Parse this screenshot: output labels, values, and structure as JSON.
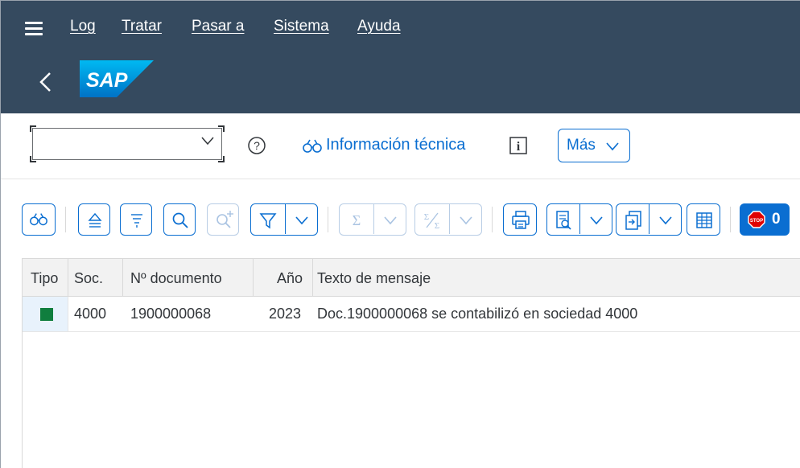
{
  "menu": {
    "items": [
      "Log",
      "Tratar",
      "Pasar a",
      "Sistema",
      "Ayuda"
    ]
  },
  "shell": {
    "logo_text": "SAP"
  },
  "toolbar1": {
    "combo_value": "",
    "info_label": "Información técnica",
    "more_label": "Más"
  },
  "toolbar2": {
    "buttons": [
      "details-icon",
      "sort-ascending-icon",
      "sort-descending-icon",
      "search-icon",
      "search-next-icon",
      "filter-icon",
      "dropdown-icon",
      "sum-icon",
      "dropdown-icon",
      "subtotal-icon",
      "dropdown-icon",
      "print-icon",
      "view-icon",
      "dropdown-icon",
      "export-icon",
      "dropdown-icon",
      "layout-grid-icon"
    ],
    "stop_count": "0"
  },
  "table": {
    "columns": [
      "Tipo",
      "Soc.",
      "Nº documento",
      "Año",
      "Texto de mensaje"
    ],
    "rows": [
      {
        "status": "green",
        "soc": "4000",
        "documento": "1900000068",
        "anio": "2023",
        "texto": "Doc.1900000068 se contabilizó en sociedad 4000"
      }
    ]
  },
  "colors": {
    "shell_bg": "#354a5f",
    "accent": "#0a6ed1",
    "status_success": "#107e3e"
  }
}
